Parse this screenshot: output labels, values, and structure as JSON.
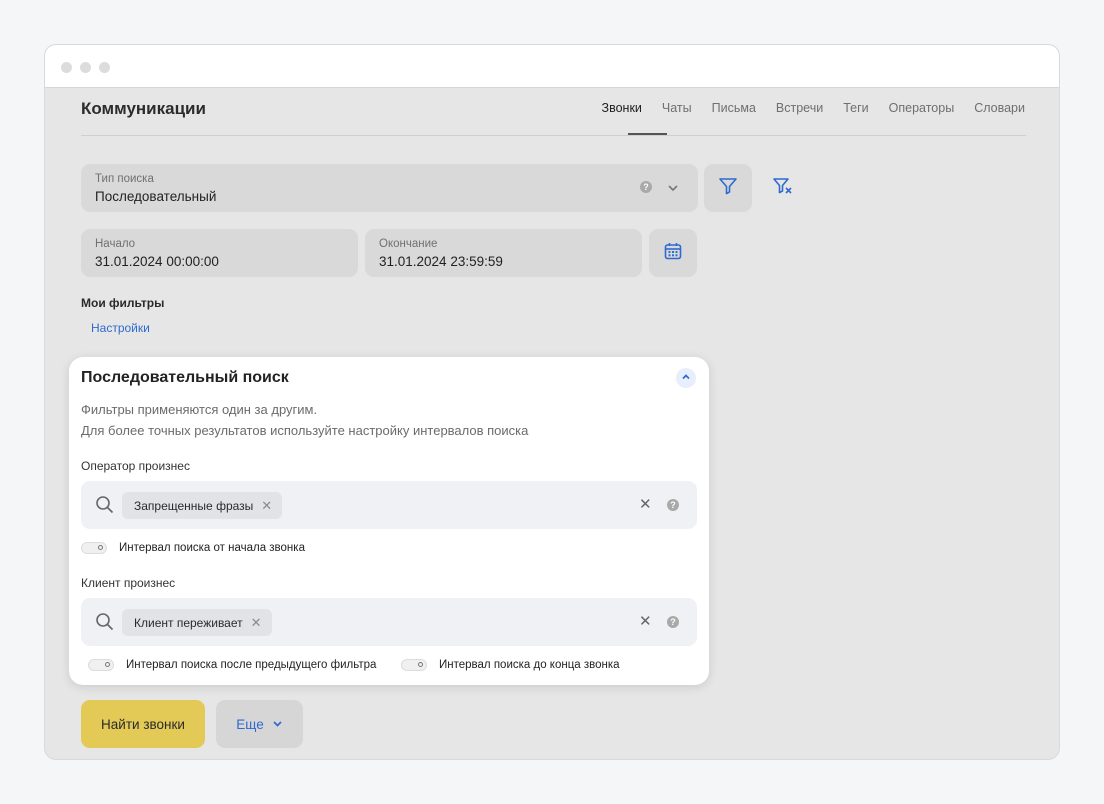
{
  "header": {
    "title": "Коммуникации",
    "tabs": [
      {
        "label": "Звонки",
        "active": true
      },
      {
        "label": "Чаты"
      },
      {
        "label": "Письма"
      },
      {
        "label": "Встречи"
      },
      {
        "label": "Теги"
      },
      {
        "label": "Операторы"
      },
      {
        "label": "Словари"
      }
    ]
  },
  "search_type": {
    "label": "Тип поиска",
    "value": "Последовательный"
  },
  "dates": {
    "start_label": "Начало",
    "start_value": "31.01.2024 00:00:00",
    "end_label": "Окончание",
    "end_value": "31.01.2024 23:59:59"
  },
  "my_filters": {
    "label": "Мои фильтры",
    "settings_link": "Настройки"
  },
  "panel": {
    "title": "Последовательный поиск",
    "desc_line1": "Фильтры применяются один за другим.",
    "desc_line2": "Для более точных результатов используйте настройку интервалов поиска",
    "operator": {
      "label": "Оператор произнес",
      "chip": "Запрещенные фразы",
      "toggle_label": "Интервал поиска от начала звонка"
    },
    "client": {
      "label": "Клиент произнес",
      "chip": "Клиент переживает",
      "toggle_after_label": "Интервал поиска после предыдущего фильтра",
      "toggle_end_label": "Интервал поиска до конца звонка"
    }
  },
  "actions": {
    "find_label": "Найти звонки",
    "more_label": "Еще"
  },
  "colors": {
    "accent": "#2f6ad0",
    "primary_button": "#e3c955"
  }
}
